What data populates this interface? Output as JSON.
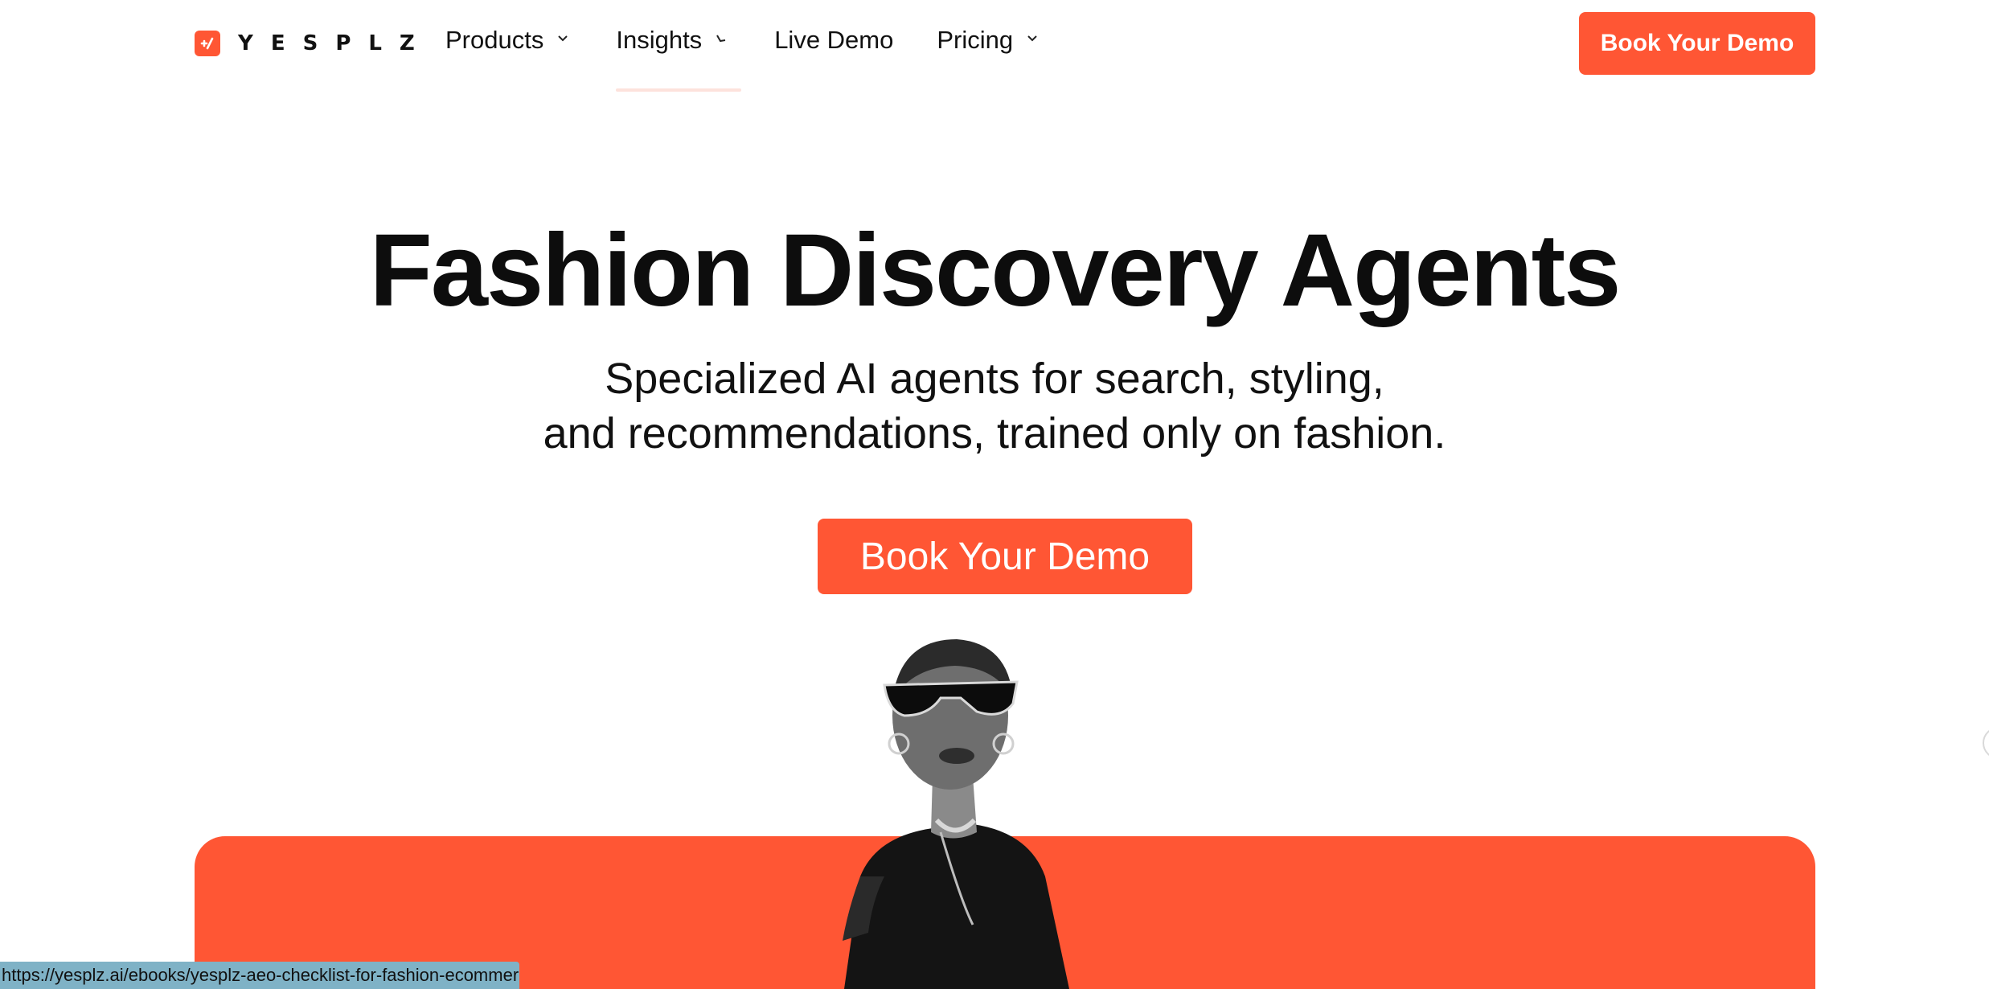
{
  "logo": {
    "icon": "yesplz-logo-icon",
    "text": "YESPLZ"
  },
  "nav": {
    "items": [
      {
        "label": "Products",
        "icon": "chevron-down-icon"
      },
      {
        "label": "Insights",
        "icon": "chevron-down-icon"
      },
      {
        "label": "Live Demo"
      },
      {
        "label": "Pricing",
        "icon": "chevron-down-icon"
      }
    ],
    "cta_label": "Book Your Demo"
  },
  "hero": {
    "title": "Fashion Discovery Agents",
    "subtitle_line1": "Specialized AI agents for search, styling,",
    "subtitle_line2": "and recommendations, trained only on fashion.",
    "cta_label": "Book Your Demo"
  },
  "status_bar": {
    "url": "https://yesplz.ai/ebooks/yesplz-aeo-checklist-for-fashion-ecommerce"
  },
  "colors": {
    "accent": "#ff5634",
    "text": "#111111",
    "status_bar": "#7fb2c6"
  }
}
